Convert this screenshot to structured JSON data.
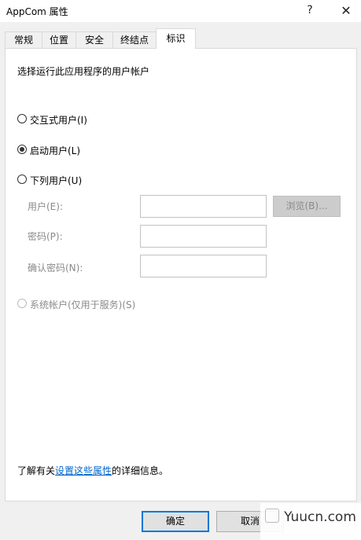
{
  "window": {
    "title": "AppCom 属性",
    "help_glyph": "?",
    "close_glyph": "✕"
  },
  "tabs": [
    {
      "label": "常规"
    },
    {
      "label": "位置"
    },
    {
      "label": "安全"
    },
    {
      "label": "终结点"
    },
    {
      "label": "标识",
      "active": true
    }
  ],
  "identity": {
    "heading": "选择运行此应用程序的用户帐户",
    "options": [
      {
        "label": "交互式用户(I)",
        "selected": false,
        "enabled": true
      },
      {
        "label": "启动用户(L)",
        "selected": true,
        "enabled": true
      },
      {
        "label": "下列用户(U)",
        "selected": false,
        "enabled": true
      }
    ],
    "user_label": "用户(E):",
    "user_value": "",
    "browse_label": "浏览(B)...",
    "password_label": "密码(P):",
    "password_value": "",
    "confirm_label": "确认密码(N):",
    "confirm_value": "",
    "system_account_label": "系统帐户(仅用于服务)(S)",
    "info_prefix": "了解有关",
    "info_link": "设置这些属性",
    "info_suffix": "的详细信息。"
  },
  "footer": {
    "ok_label": "确定",
    "cancel_label": "取消"
  },
  "watermark": {
    "text": "Yuucn.com"
  },
  "colors": {
    "link": "#0066cc",
    "default_button_border": "#0078d7",
    "panel_bg": "#ffffff",
    "window_bg": "#f0f0f0"
  }
}
